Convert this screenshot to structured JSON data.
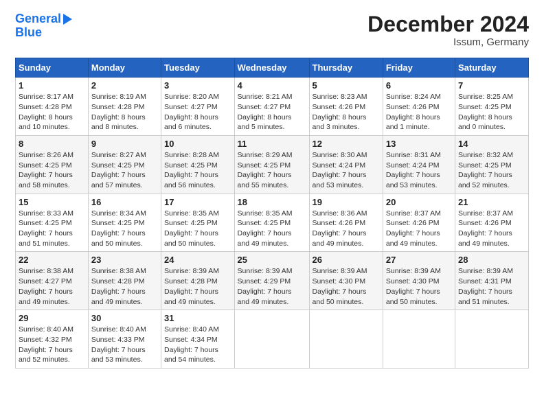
{
  "logo": {
    "line1": "General",
    "line2": "Blue"
  },
  "title": "December 2024",
  "subtitle": "Issum, Germany",
  "days_of_week": [
    "Sunday",
    "Monday",
    "Tuesday",
    "Wednesday",
    "Thursday",
    "Friday",
    "Saturday"
  ],
  "weeks": [
    [
      {
        "day": "1",
        "details": "Sunrise: 8:17 AM\nSunset: 4:28 PM\nDaylight: 8 hours\nand 10 minutes."
      },
      {
        "day": "2",
        "details": "Sunrise: 8:19 AM\nSunset: 4:28 PM\nDaylight: 8 hours\nand 8 minutes."
      },
      {
        "day": "3",
        "details": "Sunrise: 8:20 AM\nSunset: 4:27 PM\nDaylight: 8 hours\nand 6 minutes."
      },
      {
        "day": "4",
        "details": "Sunrise: 8:21 AM\nSunset: 4:27 PM\nDaylight: 8 hours\nand 5 minutes."
      },
      {
        "day": "5",
        "details": "Sunrise: 8:23 AM\nSunset: 4:26 PM\nDaylight: 8 hours\nand 3 minutes."
      },
      {
        "day": "6",
        "details": "Sunrise: 8:24 AM\nSunset: 4:26 PM\nDaylight: 8 hours\nand 1 minute."
      },
      {
        "day": "7",
        "details": "Sunrise: 8:25 AM\nSunset: 4:25 PM\nDaylight: 8 hours\nand 0 minutes."
      }
    ],
    [
      {
        "day": "8",
        "details": "Sunrise: 8:26 AM\nSunset: 4:25 PM\nDaylight: 7 hours\nand 58 minutes."
      },
      {
        "day": "9",
        "details": "Sunrise: 8:27 AM\nSunset: 4:25 PM\nDaylight: 7 hours\nand 57 minutes."
      },
      {
        "day": "10",
        "details": "Sunrise: 8:28 AM\nSunset: 4:25 PM\nDaylight: 7 hours\nand 56 minutes."
      },
      {
        "day": "11",
        "details": "Sunrise: 8:29 AM\nSunset: 4:25 PM\nDaylight: 7 hours\nand 55 minutes."
      },
      {
        "day": "12",
        "details": "Sunrise: 8:30 AM\nSunset: 4:24 PM\nDaylight: 7 hours\nand 53 minutes."
      },
      {
        "day": "13",
        "details": "Sunrise: 8:31 AM\nSunset: 4:24 PM\nDaylight: 7 hours\nand 53 minutes."
      },
      {
        "day": "14",
        "details": "Sunrise: 8:32 AM\nSunset: 4:25 PM\nDaylight: 7 hours\nand 52 minutes."
      }
    ],
    [
      {
        "day": "15",
        "details": "Sunrise: 8:33 AM\nSunset: 4:25 PM\nDaylight: 7 hours\nand 51 minutes."
      },
      {
        "day": "16",
        "details": "Sunrise: 8:34 AM\nSunset: 4:25 PM\nDaylight: 7 hours\nand 50 minutes."
      },
      {
        "day": "17",
        "details": "Sunrise: 8:35 AM\nSunset: 4:25 PM\nDaylight: 7 hours\nand 50 minutes."
      },
      {
        "day": "18",
        "details": "Sunrise: 8:35 AM\nSunset: 4:25 PM\nDaylight: 7 hours\nand 49 minutes."
      },
      {
        "day": "19",
        "details": "Sunrise: 8:36 AM\nSunset: 4:26 PM\nDaylight: 7 hours\nand 49 minutes."
      },
      {
        "day": "20",
        "details": "Sunrise: 8:37 AM\nSunset: 4:26 PM\nDaylight: 7 hours\nand 49 minutes."
      },
      {
        "day": "21",
        "details": "Sunrise: 8:37 AM\nSunset: 4:26 PM\nDaylight: 7 hours\nand 49 minutes."
      }
    ],
    [
      {
        "day": "22",
        "details": "Sunrise: 8:38 AM\nSunset: 4:27 PM\nDaylight: 7 hours\nand 49 minutes."
      },
      {
        "day": "23",
        "details": "Sunrise: 8:38 AM\nSunset: 4:28 PM\nDaylight: 7 hours\nand 49 minutes."
      },
      {
        "day": "24",
        "details": "Sunrise: 8:39 AM\nSunset: 4:28 PM\nDaylight: 7 hours\nand 49 minutes."
      },
      {
        "day": "25",
        "details": "Sunrise: 8:39 AM\nSunset: 4:29 PM\nDaylight: 7 hours\nand 49 minutes."
      },
      {
        "day": "26",
        "details": "Sunrise: 8:39 AM\nSunset: 4:30 PM\nDaylight: 7 hours\nand 50 minutes."
      },
      {
        "day": "27",
        "details": "Sunrise: 8:39 AM\nSunset: 4:30 PM\nDaylight: 7 hours\nand 50 minutes."
      },
      {
        "day": "28",
        "details": "Sunrise: 8:39 AM\nSunset: 4:31 PM\nDaylight: 7 hours\nand 51 minutes."
      }
    ],
    [
      {
        "day": "29",
        "details": "Sunrise: 8:40 AM\nSunset: 4:32 PM\nDaylight: 7 hours\nand 52 minutes."
      },
      {
        "day": "30",
        "details": "Sunrise: 8:40 AM\nSunset: 4:33 PM\nDaylight: 7 hours\nand 53 minutes."
      },
      {
        "day": "31",
        "details": "Sunrise: 8:40 AM\nSunset: 4:34 PM\nDaylight: 7 hours\nand 54 minutes."
      },
      null,
      null,
      null,
      null
    ]
  ]
}
